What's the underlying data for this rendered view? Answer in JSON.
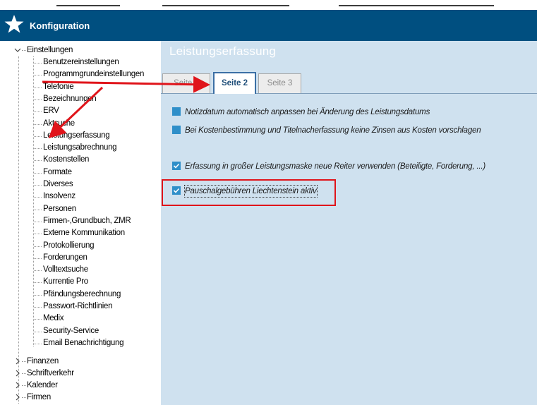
{
  "app": {
    "title": "Konfiguration"
  },
  "sidebar": {
    "root": {
      "label": "Einstellungen",
      "expanded": true
    },
    "children": [
      "Benutzereinstellungen",
      "Programmgrundeinstellungen",
      "Telefonie",
      "Bezeichnungen",
      "ERV",
      "Aktsuche",
      "Leistungserfassung",
      "Leistungsabrechnung",
      "Kostenstellen",
      "Formate",
      "Diverses",
      "Insolvenz",
      "Personen",
      "Firmen-,Grundbuch, ZMR",
      "Externe Kommunikation",
      "Protokollierung",
      "Forderungen",
      "Volltextsuche",
      "Kurrentie Pro",
      "Pfändungsberechnung",
      "Passwort-Richtlinien",
      "Medix",
      "Security-Service",
      "Email Benachrichtigung"
    ],
    "collapsed": [
      "Finanzen",
      "Schriftverkehr",
      "Kalender",
      "Firmen"
    ]
  },
  "main": {
    "title": "Leistungserfassung",
    "tabs": [
      {
        "label": "Seite 1",
        "active": false
      },
      {
        "label": "Seite 2",
        "active": true
      },
      {
        "label": "Seite 3",
        "active": false
      }
    ],
    "options": [
      {
        "label": "Notizdatum automatisch anpassen bei Änderung des Leistungsdatums",
        "checked": false
      },
      {
        "label": "Bei Kostenbestimmung und Titelnacherfassung keine Zinsen aus Kosten vorschlagen",
        "checked": false
      },
      {
        "label": "Erfassung in großer Leistungsmaske neue Reiter verwenden (Beteiligte, Forderung, ...)",
        "checked": true
      },
      {
        "label": "Pauschalgebühren Liechtenstein aktiv",
        "checked": true
      }
    ]
  },
  "colors": {
    "titlebar": "#004f80",
    "panel": "#cfe1ef",
    "checkbox": "#2f8fc9",
    "annotation": "#e0141a"
  }
}
